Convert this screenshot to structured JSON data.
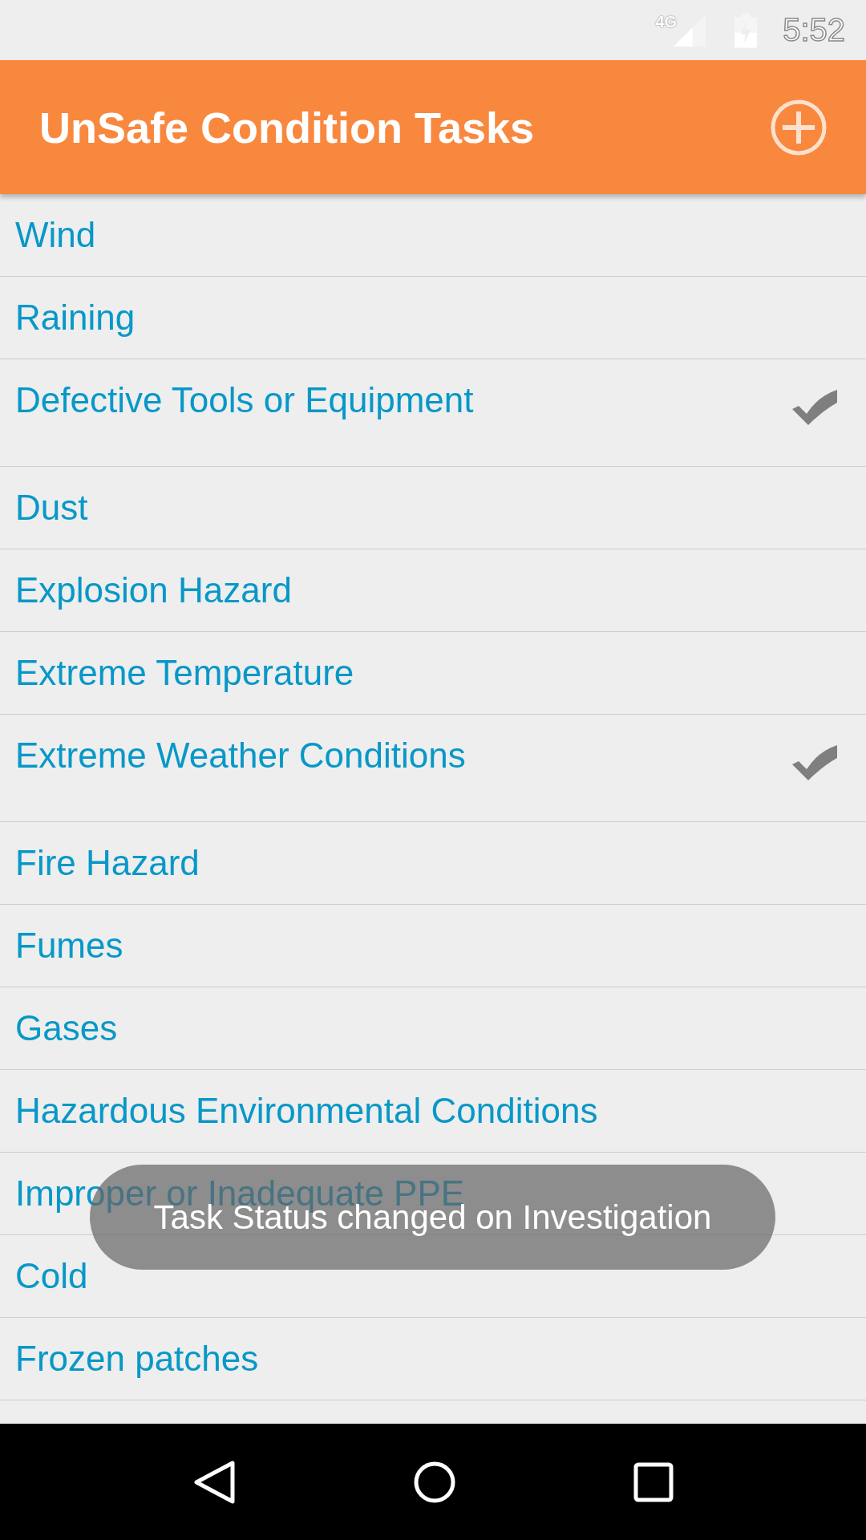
{
  "status_bar": {
    "network": "4G",
    "time": "5:52"
  },
  "app_bar": {
    "title": "UnSafe Condition Tasks"
  },
  "tasks": [
    {
      "label": "Wind",
      "checked": false
    },
    {
      "label": "Raining",
      "checked": false
    },
    {
      "label": "Defective Tools or Equipment",
      "checked": true
    },
    {
      "label": "Dust",
      "checked": false
    },
    {
      "label": "Explosion Hazard",
      "checked": false
    },
    {
      "label": "Extreme Temperature",
      "checked": false
    },
    {
      "label": "Extreme Weather Conditions",
      "checked": true
    },
    {
      "label": "Fire Hazard",
      "checked": false
    },
    {
      "label": "Fumes",
      "checked": false
    },
    {
      "label": "Gases",
      "checked": false
    },
    {
      "label": "Hazardous Environmental Conditions",
      "checked": false
    },
    {
      "label": "Improper or Inadequate PPE",
      "checked": false
    },
    {
      "label": "Cold",
      "checked": false
    },
    {
      "label": "Frozen patches",
      "checked": false
    }
  ],
  "toast": {
    "message": "Task Status changed on Investigation"
  }
}
